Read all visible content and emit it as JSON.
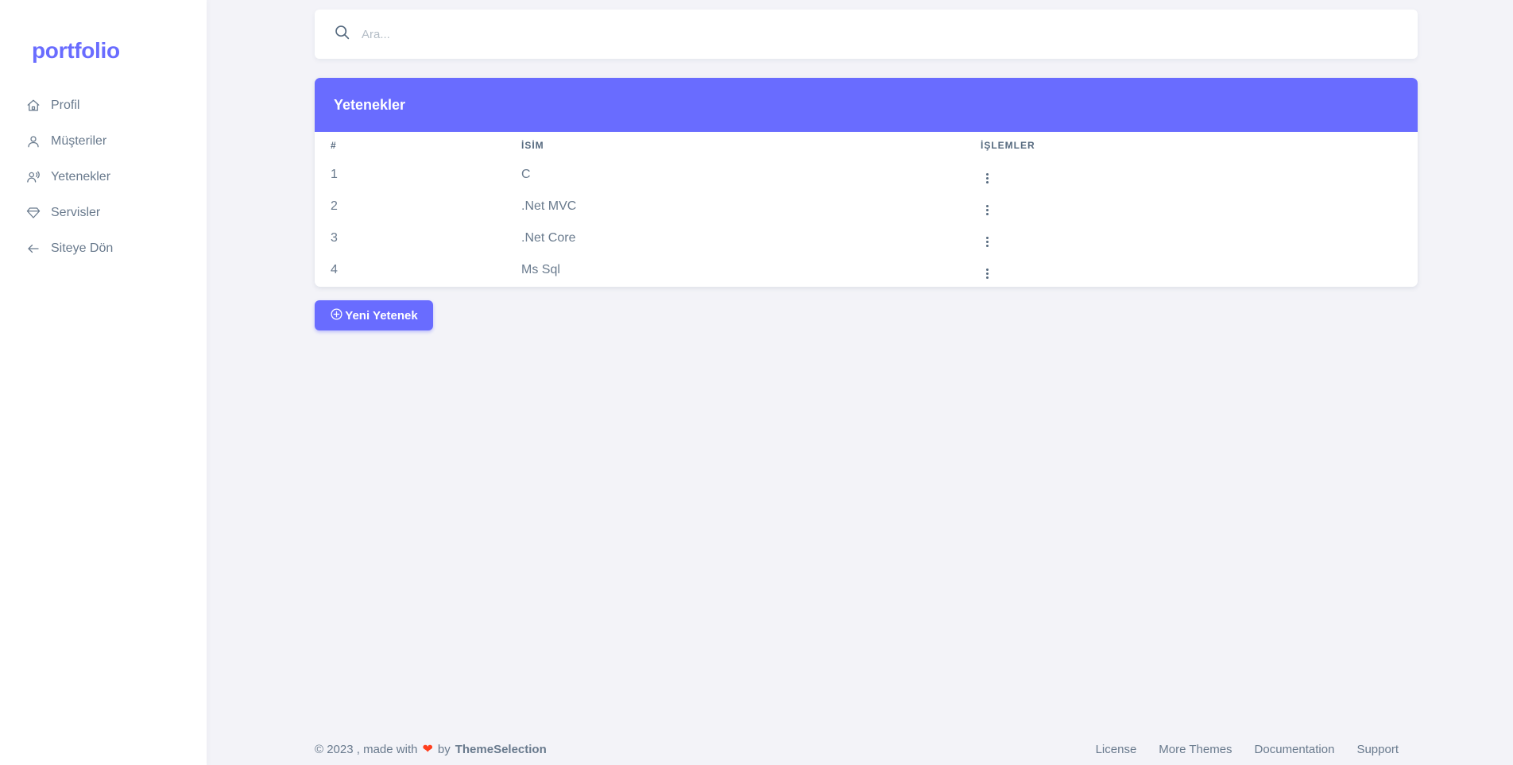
{
  "sidebar": {
    "brand": "portfolio",
    "items": [
      {
        "label": "Profil",
        "icon": "home-icon"
      },
      {
        "label": "Müşteriler",
        "icon": "user-icon"
      },
      {
        "label": "Yetenekler",
        "icon": "user-voice-icon"
      },
      {
        "label": "Servisler",
        "icon": "diamond-icon"
      },
      {
        "label": "Siteye Dön",
        "icon": "arrow-left-icon"
      }
    ]
  },
  "search": {
    "placeholder": "Ara...",
    "value": ""
  },
  "card": {
    "title": "Yetenekler",
    "columns": [
      "#",
      "İSİM",
      "İŞLEMLER"
    ],
    "rows": [
      {
        "id": "1",
        "name": "C"
      },
      {
        "id": "2",
        "name": ".Net MVC"
      },
      {
        "id": "3",
        "name": ".Net Core"
      },
      {
        "id": "4",
        "name": "Ms Sql"
      }
    ]
  },
  "add_button": {
    "label": "Yeni Yetenek",
    "icon": "plus-circle-icon"
  },
  "footer": {
    "copyright": "© 2023 , made with",
    "by": "by",
    "brand": "ThemeSelection",
    "links": [
      "License",
      "More Themes",
      "Documentation",
      "Support"
    ]
  },
  "colors": {
    "accent": "#696cff",
    "heart": "#ff3e1d",
    "background": "#f3f3f8"
  }
}
